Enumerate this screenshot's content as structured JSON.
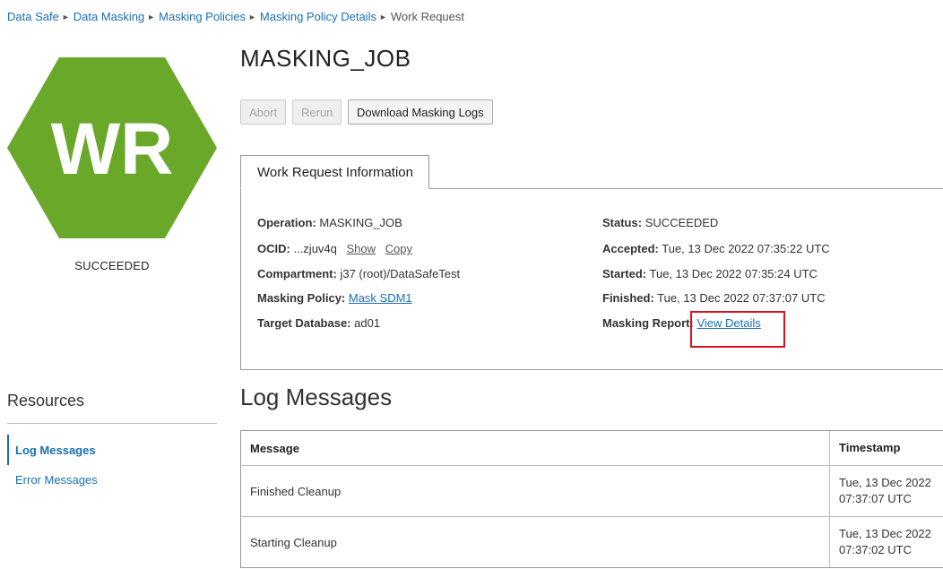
{
  "breadcrumb": [
    {
      "label": "Data Safe",
      "link": true
    },
    {
      "label": "Data Masking",
      "link": true
    },
    {
      "label": "Masking Policies",
      "link": true
    },
    {
      "label": "Masking Policy Details",
      "link": true
    },
    {
      "label": "Work Request",
      "link": false
    }
  ],
  "badge": {
    "text": "WR",
    "color": "#6aa82a"
  },
  "left_status": "SUCCEEDED",
  "title": "MASKING_JOB",
  "buttons": {
    "abort": "Abort",
    "rerun": "Rerun",
    "download": "Download Masking Logs"
  },
  "tab_label": "Work Request Information",
  "info": {
    "operation": {
      "label": "Operation:",
      "value": "MASKING_JOB"
    },
    "ocid": {
      "label": "OCID:",
      "value": "...zjuv4q",
      "show": "Show",
      "copy": "Copy"
    },
    "compartment": {
      "label": "Compartment:",
      "value": "j37 (root)/DataSafeTest"
    },
    "masking_policy": {
      "label": "Masking Policy:",
      "value": "Mask SDM1"
    },
    "target_database": {
      "label": "Target Database:",
      "value": "ad01"
    },
    "status": {
      "label": "Status:",
      "value": "SUCCEEDED"
    },
    "accepted": {
      "label": "Accepted:",
      "value": "Tue, 13 Dec 2022 07:35:22 UTC"
    },
    "started": {
      "label": "Started:",
      "value": "Tue, 13 Dec 2022 07:35:24 UTC"
    },
    "finished": {
      "label": "Finished:",
      "value": "Tue, 13 Dec 2022 07:37:07 UTC"
    },
    "masking_report": {
      "label": "Masking Report:",
      "value": "View Details"
    }
  },
  "resources": {
    "title": "Resources",
    "items": [
      "Log Messages",
      "Error Messages"
    ]
  },
  "log": {
    "title": "Log Messages",
    "columns": [
      "Message",
      "Timestamp"
    ],
    "rows": [
      {
        "message": "Finished Cleanup",
        "ts1": "Tue, 13 Dec 2022",
        "ts2": "07:37:07 UTC"
      },
      {
        "message": "Starting Cleanup",
        "ts1": "Tue, 13 Dec 2022",
        "ts2": "07:37:02 UTC"
      }
    ]
  }
}
